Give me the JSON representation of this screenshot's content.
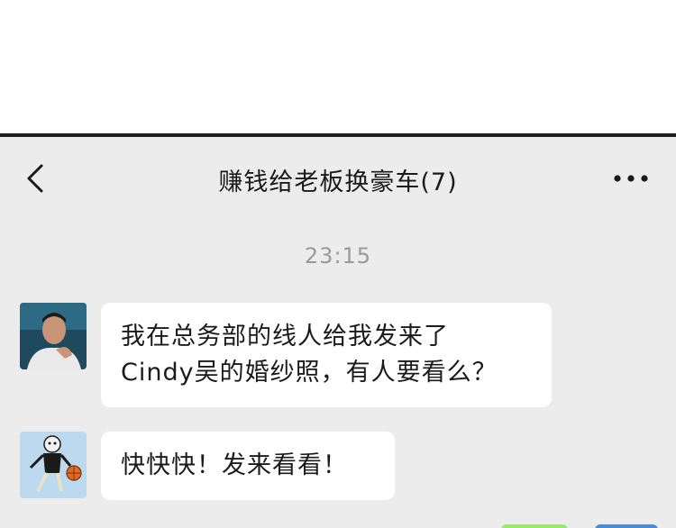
{
  "chat": {
    "title": "赚钱给老板换豪车(7)",
    "timestamp": "23:15"
  },
  "messages": [
    {
      "line1": "我在总务部的线人给我发来了",
      "line2": "Cindy吴的婚纱照，有人要看么？"
    },
    {
      "line1": "快快快！发来看看！"
    }
  ],
  "icons": {
    "back": "chevron-left-icon",
    "more": "more-dots-icon"
  },
  "colors": {
    "screen_bg": "#ececec",
    "bubble_bg": "#ffffff",
    "timestamp": "#9a9a9a",
    "self_bubble": "#95ec69"
  }
}
